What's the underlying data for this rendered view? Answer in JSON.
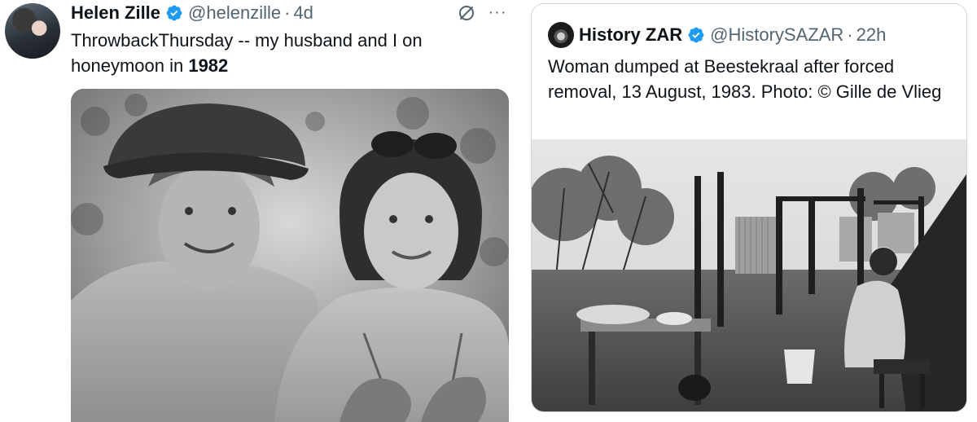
{
  "left_tweet": {
    "author": {
      "display_name": "Helen Zille",
      "handle": "@helenzille",
      "separator": "·",
      "timestamp": "4d",
      "verified_icon": "verified-badge-icon"
    },
    "text_main": "ThrowbackThursday  --  my husband and I on honeymoon in ",
    "text_bold": "1982",
    "actions": {
      "grok_icon": "grok-icon",
      "more_icon": "more-horizontal-icon",
      "more_label": "···"
    },
    "media": {
      "description_icon": "photo"
    }
  },
  "right_tweet": {
    "author": {
      "display_name": "History ZAR",
      "handle": "@HistorySAZAR",
      "separator": "·",
      "timestamp": "22h",
      "verified_icon": "verified-badge-icon"
    },
    "text": "Woman dumped at Beestekraal after forced removal, 13 August, 1983. Photo: © Gille de Vlieg",
    "media": {
      "description_icon": "photo"
    }
  },
  "colors": {
    "text_primary": "#0f1419",
    "text_secondary": "#536471",
    "verified_blue": "#1d9bf0",
    "card_border": "#cfd9de"
  }
}
